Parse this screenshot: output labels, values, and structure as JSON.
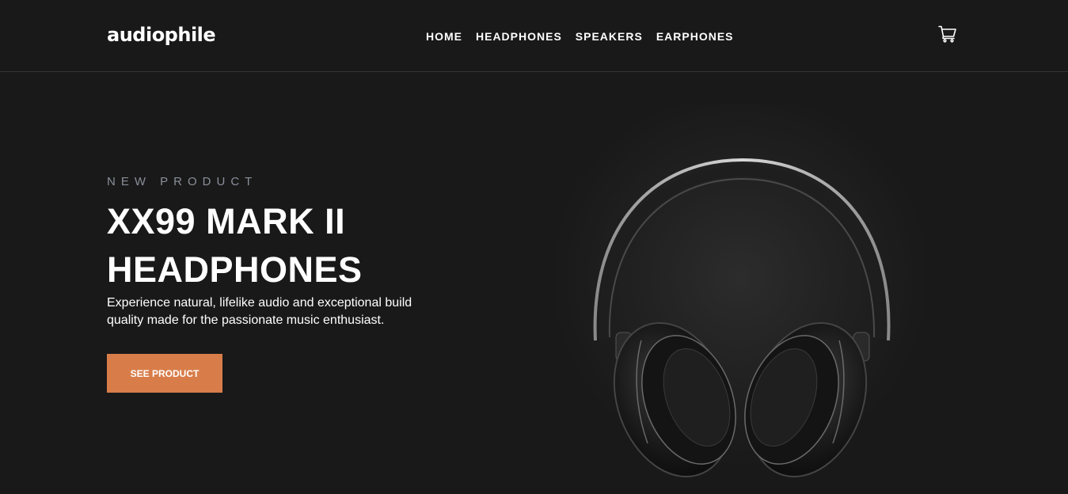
{
  "header": {
    "logo": "audiophile",
    "nav": [
      {
        "label": "HOME"
      },
      {
        "label": "HEADPHONES"
      },
      {
        "label": "SPEAKERS"
      },
      {
        "label": "EARPHONES"
      }
    ],
    "cart_icon": "cart-icon"
  },
  "hero": {
    "overline": "NEW PRODUCT",
    "title_line1": "XX99 MARK II",
    "title_line2": "HEADPHONES",
    "description": "Experience natural, lifelike audio and exceptional build quality made for the passionate music enthusiast.",
    "cta_label": "SEE PRODUCT",
    "image_icon": "headphones-image"
  },
  "colors": {
    "background": "#191919",
    "accent": "#d87d4a",
    "overline": "#8a8f99",
    "text": "#ffffff",
    "divider": "#353535"
  }
}
